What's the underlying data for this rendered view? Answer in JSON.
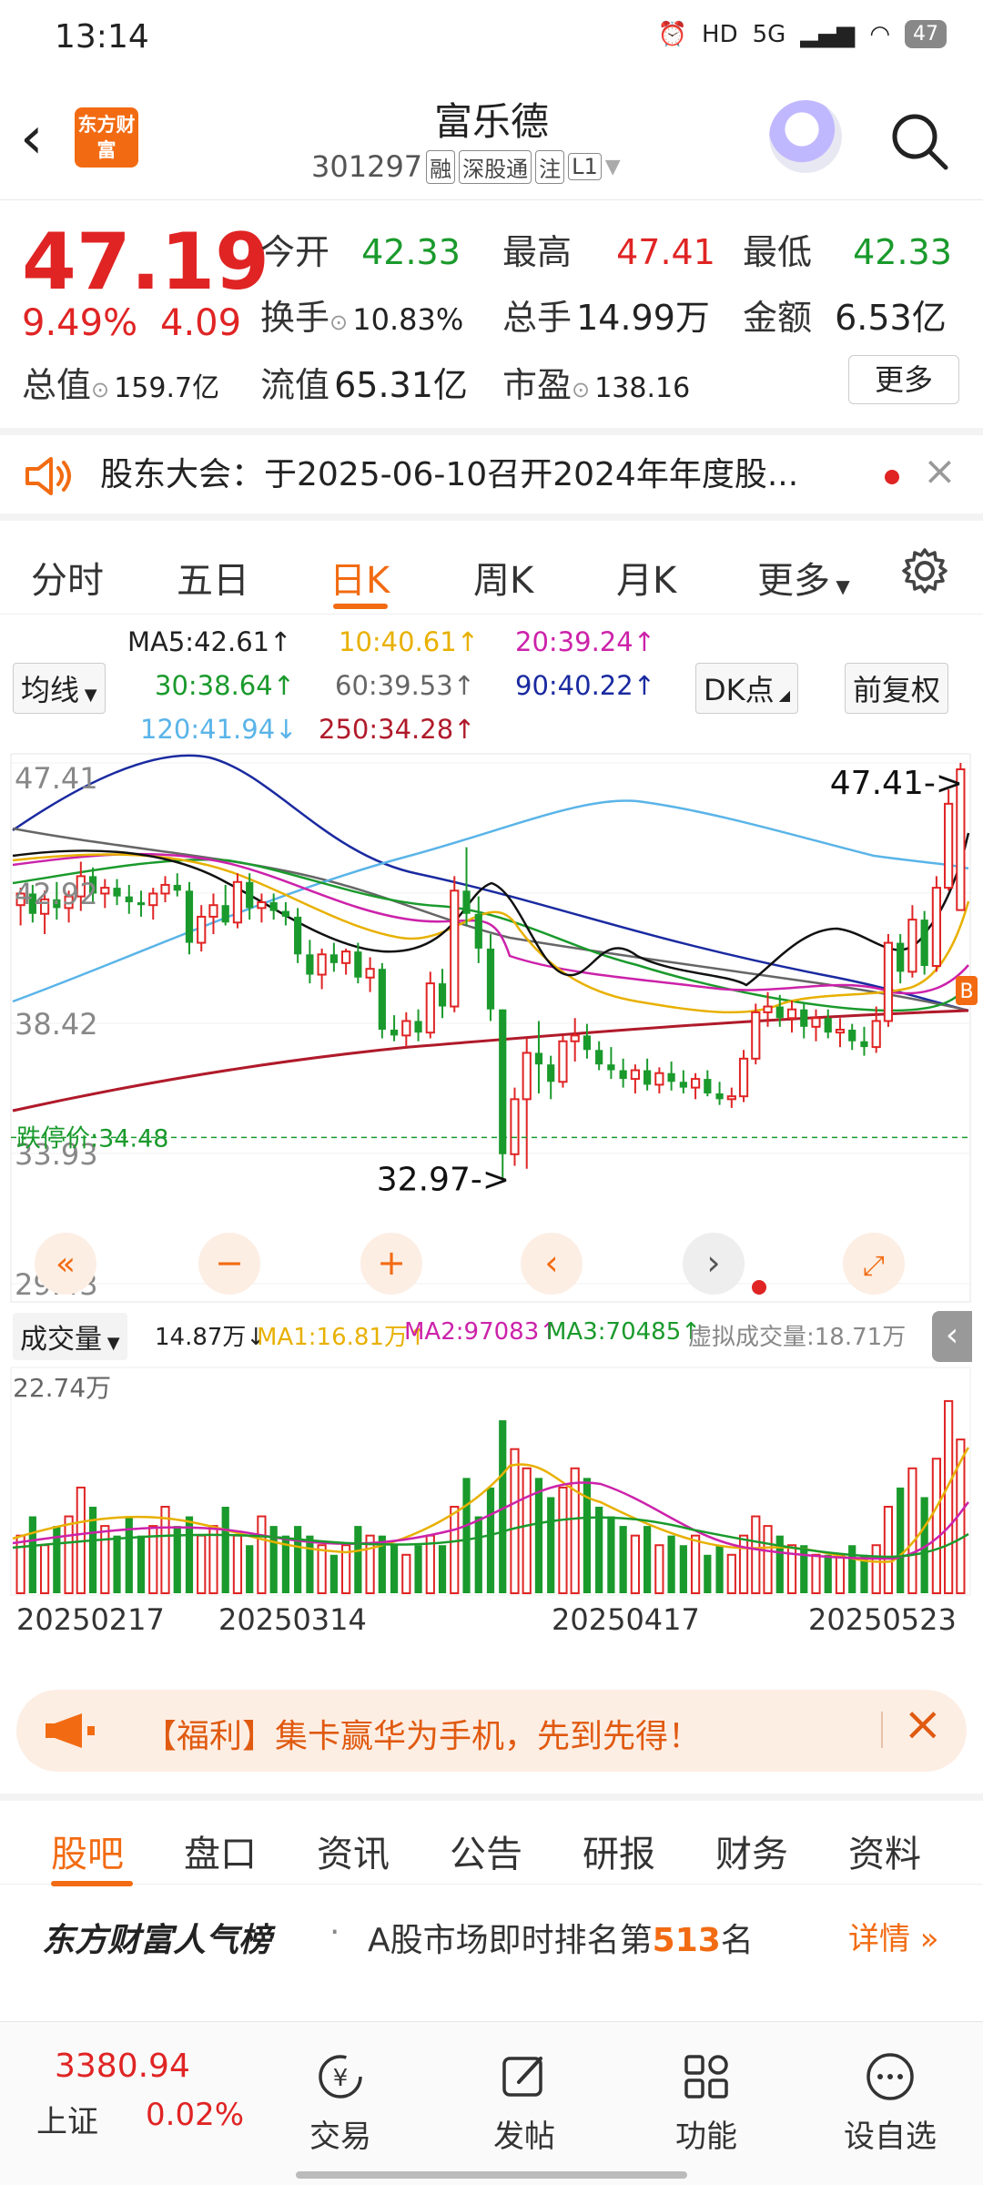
{
  "status_bar": {
    "time": "13:14",
    "network": "5G",
    "battery": "47"
  },
  "header": {
    "logo_text": "东方财富",
    "stock_name": "富乐德",
    "stock_code": "301297",
    "tags": [
      "融",
      "深股通",
      "注",
      "L1"
    ]
  },
  "quote": {
    "price": "47.19",
    "change_pct": "9.49%",
    "change_amt": "4.09",
    "fields": [
      {
        "label": "今开",
        "value": "42.33",
        "color": "#1a9a2c"
      },
      {
        "label": "最高",
        "value": "47.41",
        "color": "#e02424"
      },
      {
        "label": "最低",
        "value": "42.33",
        "color": "#1a9a2c"
      },
      {
        "label": "换手",
        "value": "10.83%",
        "color": "#222222"
      },
      {
        "label": "总手",
        "value": "14.99万",
        "color": "#222222"
      },
      {
        "label": "金额",
        "value": "6.53亿",
        "color": "#222222"
      },
      {
        "label": "总值",
        "value": "159.7亿",
        "color": "#222222"
      },
      {
        "label": "流值",
        "value": "65.31亿",
        "color": "#222222"
      },
      {
        "label": "市盈",
        "value": "138.16",
        "color": "#222222"
      }
    ],
    "more_label": "更多"
  },
  "notice": {
    "text": "股东大会：于2025-06-10召开2024年年度股..."
  },
  "kline_tabs": [
    "分时",
    "五日",
    "日K",
    "周K",
    "月K",
    "更多"
  ],
  "ma_panel": {
    "type_label": "均线",
    "ma5": "MA5:42.61↑",
    "ma10": "10:40.61↑",
    "ma20": "20:39.24↑",
    "ma30": "30:38.64↑",
    "ma60": "60:39.53↑",
    "ma90": "90:40.22↑",
    "ma120": "120:41.94↓",
    "ma250": "250:34.28↑",
    "dk_label": "DK点",
    "adjust_label": "前复权"
  },
  "chart_data": {
    "type": "candlestick",
    "y_labels": [
      "47.41",
      "42.92",
      "38.42",
      "33.93",
      "29.43"
    ],
    "ylim": [
      29.43,
      47.41
    ],
    "limit_down_label": "跌停价:34.48",
    "limit_down_value": 34.48,
    "high_annotation": "47.41->",
    "low_annotation": "32.97->",
    "x_labels": [
      "20250217",
      "20250314",
      "20250417",
      "20250523"
    ],
    "candles": [
      [
        42.5,
        43.1,
        41.8,
        42.9
      ],
      [
        42.9,
        43.2,
        41.9,
        42.2
      ],
      [
        42.2,
        43.0,
        41.5,
        42.7
      ],
      [
        42.7,
        43.3,
        42.0,
        42.4
      ],
      [
        42.4,
        43.0,
        41.9,
        42.8
      ],
      [
        42.8,
        44.0,
        42.3,
        43.5
      ],
      [
        43.5,
        43.8,
        42.6,
        42.9
      ],
      [
        42.9,
        43.4,
        42.4,
        43.1
      ],
      [
        43.1,
        43.4,
        42.5,
        42.8
      ],
      [
        42.8,
        43.2,
        42.2,
        42.6
      ],
      [
        42.6,
        43.0,
        42.1,
        42.5
      ],
      [
        42.5,
        43.1,
        42.0,
        42.9
      ],
      [
        42.9,
        43.5,
        42.6,
        43.2
      ],
      [
        43.2,
        43.6,
        42.8,
        43.0
      ],
      [
        43.0,
        43.3,
        40.8,
        41.2
      ],
      [
        41.2,
        42.5,
        40.9,
        42.1
      ],
      [
        42.1,
        42.9,
        41.5,
        42.5
      ],
      [
        42.5,
        43.2,
        41.8,
        41.9
      ],
      [
        41.9,
        43.6,
        41.7,
        43.3
      ],
      [
        43.3,
        43.6,
        42.0,
        42.4
      ],
      [
        42.4,
        42.9,
        41.9,
        42.6
      ],
      [
        42.6,
        42.9,
        42.0,
        42.3
      ],
      [
        42.3,
        42.6,
        41.8,
        42.1
      ],
      [
        42.1,
        42.4,
        40.5,
        40.8
      ],
      [
        40.8,
        41.3,
        39.8,
        40.1
      ],
      [
        40.1,
        41.0,
        39.6,
        40.8
      ],
      [
        40.8,
        41.2,
        40.2,
        40.5
      ],
      [
        40.5,
        41.0,
        40.1,
        40.9
      ],
      [
        40.9,
        41.2,
        39.8,
        40.0
      ],
      [
        40.0,
        40.7,
        39.5,
        40.3
      ],
      [
        40.3,
        40.5,
        37.9,
        38.2
      ],
      [
        38.2,
        38.7,
        37.8,
        38.0
      ],
      [
        38.0,
        38.8,
        37.6,
        38.5
      ],
      [
        38.5,
        38.9,
        37.8,
        38.1
      ],
      [
        38.1,
        40.2,
        37.9,
        39.8
      ],
      [
        39.8,
        40.3,
        38.6,
        39.0
      ],
      [
        39.0,
        43.5,
        38.8,
        43.0
      ],
      [
        43.0,
        44.5,
        41.8,
        42.2
      ],
      [
        42.2,
        42.8,
        40.5,
        41.0
      ],
      [
        41.0,
        41.5,
        38.5,
        38.9
      ],
      [
        38.9,
        38.9,
        32.97,
        33.9
      ],
      [
        33.9,
        36.2,
        33.5,
        35.8
      ],
      [
        35.8,
        37.9,
        33.4,
        37.4
      ],
      [
        37.4,
        38.5,
        36.0,
        37.0
      ],
      [
        37.0,
        37.3,
        35.8,
        36.4
      ],
      [
        36.4,
        38.0,
        36.2,
        37.8
      ],
      [
        37.8,
        38.6,
        37.1,
        38.0
      ],
      [
        38.0,
        38.4,
        37.2,
        37.5
      ],
      [
        37.5,
        37.8,
        36.8,
        37.0
      ],
      [
        37.0,
        37.6,
        36.5,
        36.8
      ],
      [
        36.8,
        37.2,
        36.2,
        36.5
      ],
      [
        36.5,
        37.0,
        36.0,
        36.8
      ],
      [
        36.8,
        37.2,
        36.1,
        36.3
      ],
      [
        36.3,
        36.9,
        36.0,
        36.7
      ],
      [
        36.7,
        37.1,
        36.1,
        36.4
      ],
      [
        36.4,
        36.8,
        36.0,
        36.2
      ],
      [
        36.2,
        36.7,
        35.8,
        36.5
      ],
      [
        36.5,
        36.8,
        35.9,
        36.0
      ],
      [
        36.0,
        36.4,
        35.6,
        35.8
      ],
      [
        35.8,
        36.2,
        35.5,
        35.9
      ],
      [
        35.9,
        37.5,
        35.7,
        37.2
      ],
      [
        37.2,
        39.1,
        37.0,
        38.8
      ],
      [
        38.8,
        39.5,
        38.3,
        39.0
      ],
      [
        39.0,
        39.4,
        38.3,
        38.6
      ],
      [
        38.6,
        39.2,
        38.1,
        38.9
      ],
      [
        38.9,
        39.1,
        37.9,
        38.3
      ],
      [
        38.3,
        38.9,
        37.8,
        38.6
      ],
      [
        38.6,
        38.9,
        37.9,
        38.1
      ],
      [
        38.1,
        38.6,
        37.6,
        38.2
      ],
      [
        38.2,
        38.4,
        37.5,
        37.8
      ],
      [
        37.8,
        38.3,
        37.3,
        37.6
      ],
      [
        37.6,
        39.0,
        37.4,
        38.5
      ],
      [
        38.5,
        41.5,
        38.3,
        41.2
      ],
      [
        41.2,
        41.5,
        39.8,
        40.2
      ],
      [
        40.2,
        42.5,
        40.0,
        42.0
      ],
      [
        42.0,
        42.3,
        40.1,
        40.4
      ],
      [
        40.4,
        43.5,
        40.2,
        43.1
      ],
      [
        43.1,
        46.5,
        43.0,
        46.0
      ],
      [
        42.33,
        47.41,
        42.33,
        47.19
      ]
    ],
    "volume": {
      "label": "成交量",
      "current": "14.87万↓",
      "ma1": "MA1:16.81万↑",
      "ma2": "MA2:97083↑",
      "ma3": "MA3:70485↑",
      "virtual": "虚拟成交量:18.71万",
      "ymax_label": "22.74万",
      "ymax": 22.74,
      "values": [
        6,
        8,
        5,
        7,
        8,
        11,
        9,
        7,
        6,
        8,
        6,
        7,
        9,
        7,
        8,
        6,
        7,
        9,
        6,
        5,
        8,
        7,
        6,
        7,
        6,
        5,
        4,
        5,
        7,
        6,
        6,
        5,
        4,
        5,
        6,
        5,
        9,
        12,
        8,
        11,
        18,
        15,
        13,
        12,
        10,
        11,
        13,
        12,
        9,
        8,
        7,
        6,
        7,
        5,
        6,
        5,
        6,
        4,
        5,
        4,
        6,
        8,
        7,
        6,
        5,
        5,
        4,
        4,
        4,
        5,
        4,
        5,
        9,
        11,
        13,
        10,
        14,
        20,
        16
      ]
    }
  },
  "ad": {
    "text": "【福利】集卡赢华为手机，先到先得！"
  },
  "info_tabs": [
    "股吧",
    "盘口",
    "资讯",
    "公告",
    "研报",
    "财务",
    "资料"
  ],
  "rank": {
    "brand": "东方财富人气榜",
    "prefix": "A股市场即时排名第",
    "number": "513",
    "suffix": "名",
    "detail": "详情"
  },
  "bottom_nav": {
    "index_value": "3380.94",
    "index_name": "上证",
    "index_change": "0.02%",
    "items": [
      "交易",
      "发帖",
      "功能",
      "设自选"
    ]
  },
  "colors": {
    "up": "#e02424",
    "down": "#1a9a2c",
    "accent": "#f26b12"
  }
}
